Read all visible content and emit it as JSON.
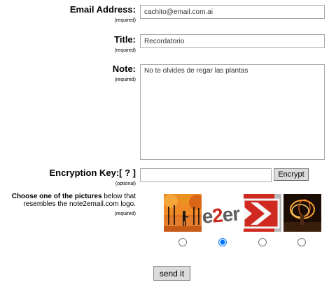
{
  "form": {
    "email": {
      "label": "Email Address:",
      "required": "(required)",
      "value": "cachito@email.com.ai"
    },
    "title": {
      "label": "Title:",
      "required": "(required)",
      "value": "Recordatorio"
    },
    "note": {
      "label": "Note:",
      "required": "(required)",
      "value": "No te olvides de regar las plantas"
    },
    "encryption": {
      "label": "Encryption Key:",
      "help": "[ ? ]",
      "optional": "(optional)",
      "value": "",
      "button": "Encrypt"
    },
    "pictures": {
      "prompt_bold": "Choose one of the pictures",
      "prompt_rest": " below that resembles the note2email.com logo.",
      "required": "(required)",
      "logo_text": {
        "e1": "e",
        "two": "2",
        "e2": "e",
        "r": "r"
      },
      "selected_index": 1
    },
    "submit": "send it"
  },
  "colors": {
    "logo_red": "#cc2a1f",
    "logo_gray": "#5e5e5e",
    "field_border": "#a9a9a9",
    "button_bg": "#dcdcdc"
  }
}
